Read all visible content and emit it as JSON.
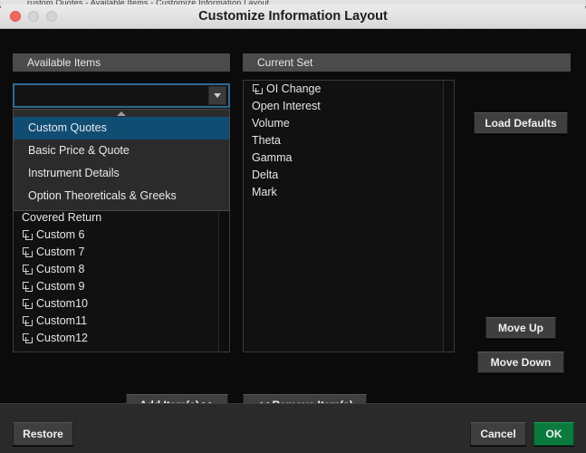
{
  "window": {
    "title": "Customize Information Layout",
    "sliver_text": "rustom Quotes - Available Items - Customize Information Layout"
  },
  "traffic_lights": {
    "close": "close-button",
    "minimize": "minimize-button",
    "maximize": "maximize-button"
  },
  "panels": {
    "available": {
      "header": "Available Items",
      "combo": {
        "value": "",
        "placeholder": "",
        "options": [
          {
            "label": "Custom Quotes",
            "selected": true
          },
          {
            "label": "Basic Price & Quote",
            "selected": false
          },
          {
            "label": "Instrument Details",
            "selected": false
          },
          {
            "label": "Option Theoreticals & Greeks",
            "selected": false
          }
        ]
      },
      "items": [
        {
          "label": "Covered Return",
          "icon": ""
        },
        {
          "label": "Custom 6",
          "icon": "formula-icon"
        },
        {
          "label": "Custom 7",
          "icon": "formula-icon"
        },
        {
          "label": "Custom 8",
          "icon": "formula-icon"
        },
        {
          "label": "Custom 9",
          "icon": "formula-icon"
        },
        {
          "label": "Custom10",
          "icon": "formula-icon"
        },
        {
          "label": "Custom11",
          "icon": "formula-icon"
        },
        {
          "label": "Custom12",
          "icon": "formula-icon"
        }
      ]
    },
    "current": {
      "header": "Current Set",
      "items": [
        {
          "label": "OI Change",
          "icon": "formula-icon"
        },
        {
          "label": "Open Interest",
          "icon": ""
        },
        {
          "label": "Volume",
          "icon": ""
        },
        {
          "label": "Theta",
          "icon": ""
        },
        {
          "label": "Gamma",
          "icon": ""
        },
        {
          "label": "Delta",
          "icon": ""
        },
        {
          "label": "Mark",
          "icon": ""
        }
      ]
    }
  },
  "buttons": {
    "load_defaults": "Load Defaults",
    "move_up": "Move Up",
    "move_down": "Move Down",
    "add_items": "Add Item(s) >>",
    "remove_items": "<< Remove Item(s)",
    "restore": "Restore",
    "cancel": "Cancel",
    "ok": "OK"
  },
  "colors": {
    "accent_selection": "#0f4d73",
    "ok_green": "#0a7a3d",
    "focus_border": "#2e6a92",
    "header_gray": "#4b4b4b"
  }
}
